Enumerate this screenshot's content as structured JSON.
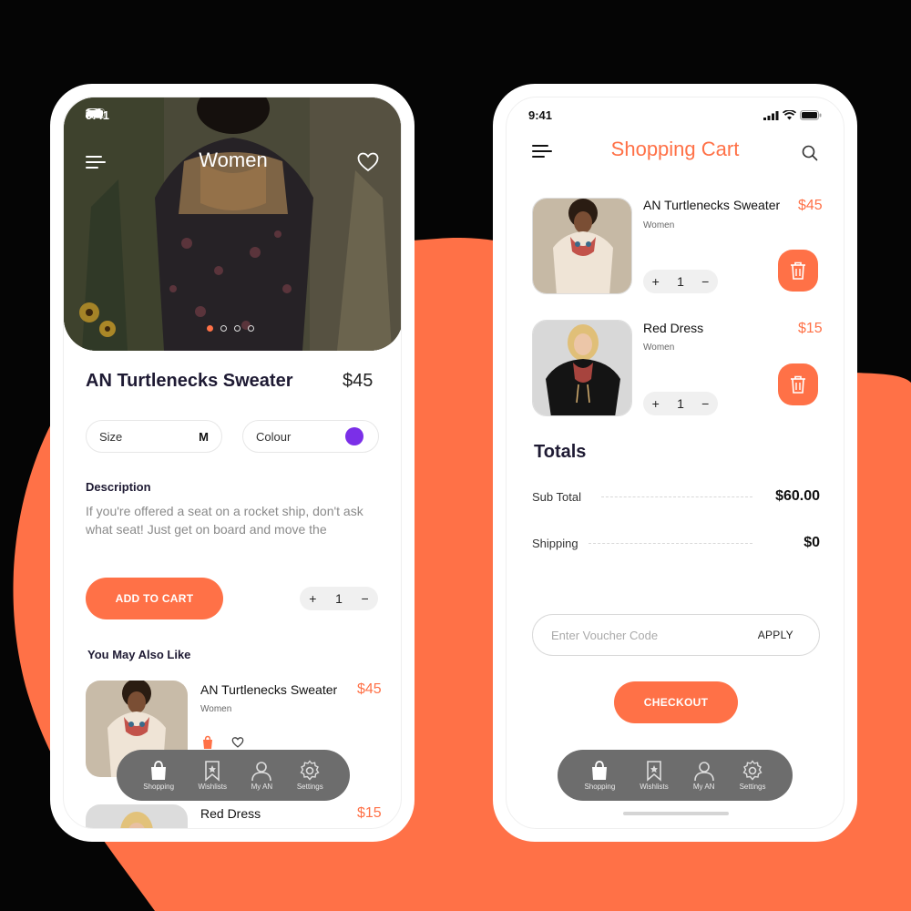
{
  "colors": {
    "accent": "#ff7147",
    "background": "#050505",
    "nav_bg": "#6d6d6d",
    "title": "#1e1a33",
    "swatch": "#7b2fe8"
  },
  "left": {
    "status_time": "9:41",
    "hero_title": "Women",
    "product": {
      "name": "AN Turtlenecks Sweater",
      "price": "$45"
    },
    "size": {
      "label": "Size",
      "value": "M"
    },
    "colour": {
      "label": "Colour"
    },
    "description": {
      "heading": "Description",
      "text": "If you're offered a seat on a rocket ship, don't ask what seat! Just get on board and move the"
    },
    "add_to_cart": "ADD TO CART",
    "qty": {
      "minus": "−",
      "plus": "+",
      "value": "1"
    },
    "also_like_heading": "You May Also Like",
    "suggestions": [
      {
        "name": "AN Turtlenecks Sweater",
        "sub": "Women",
        "price": "$45"
      },
      {
        "name": "Red Dress",
        "price": "$15"
      }
    ]
  },
  "right": {
    "status_time": "9:41",
    "title": "Shopping Cart",
    "items": [
      {
        "name": "AN Turtlenecks Sweater",
        "sub": "Women",
        "price": "$45",
        "qty": "1"
      },
      {
        "name": "Red Dress",
        "sub": "Women",
        "price": "$15",
        "qty": "1"
      }
    ],
    "totals": {
      "heading": "Totals",
      "sub_total_label": "Sub Total",
      "sub_total": "$60.00",
      "shipping_label": "Shipping",
      "shipping": "$0"
    },
    "voucher": {
      "placeholder": "Enter Voucher Code",
      "apply": "APPLY"
    },
    "checkout": "CHECKOUT"
  },
  "nav": [
    {
      "label": "Shopping",
      "icon": "shopping-bag-icon"
    },
    {
      "label": "Wishlists",
      "icon": "bookmark-icon"
    },
    {
      "label": "My AN",
      "icon": "user-icon"
    },
    {
      "label": "Settings",
      "icon": "gear-icon"
    }
  ]
}
